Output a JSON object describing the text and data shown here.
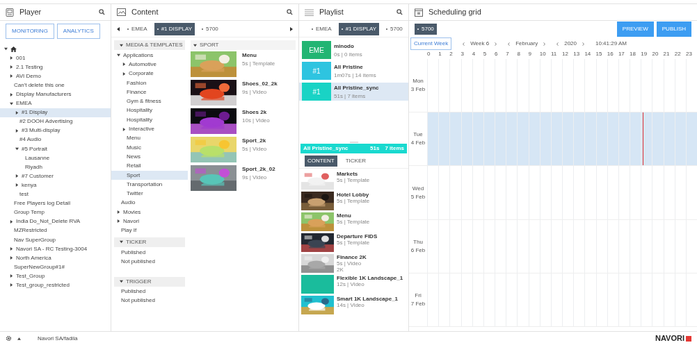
{
  "player": {
    "title": "Player",
    "buttons": [
      {
        "label": "MONITORING"
      },
      {
        "label": "ANALYTICS"
      }
    ],
    "tree": [
      {
        "kind": "home",
        "expanded": true,
        "selected": false,
        "children": [
          {
            "label": "001",
            "expanded": false,
            "selected": false
          },
          {
            "label": "2.1 Testing",
            "expanded": false,
            "selected": false
          },
          {
            "label": "AVI Demo",
            "expanded": false,
            "selected": false
          },
          {
            "label": "Can't delete this one",
            "selected": false
          },
          {
            "label": "Display Manufacturers",
            "expanded": false,
            "selected": false
          },
          {
            "label": "EMEA",
            "expanded": true,
            "selected": false,
            "children": [
              {
                "label": "#1 Display",
                "expanded": false,
                "selected": true
              },
              {
                "label": "#2 DOOH Advertising",
                "selected": false
              },
              {
                "label": "#3 Multi-display",
                "expanded": false,
                "selected": false
              },
              {
                "label": "#4 Audio",
                "selected": false
              },
              {
                "label": "#5 Portrait",
                "expanded": true,
                "selected": false,
                "children": [
                  {
                    "label": "Lausanne",
                    "selected": false
                  },
                  {
                    "label": "Riyadh",
                    "selected": false
                  }
                ]
              },
              {
                "label": "#7 Customer",
                "expanded": false,
                "selected": false
              },
              {
                "label": "kenya",
                "expanded": false,
                "selected": false
              },
              {
                "label": "test",
                "selected": false
              }
            ]
          },
          {
            "label": "Free Players log Detail",
            "selected": false
          },
          {
            "label": "Group Temp",
            "selected": false
          },
          {
            "label": "India Do_Not_Delete RVA",
            "expanded": false,
            "selected": false
          },
          {
            "label": "MZRestricted",
            "selected": false
          },
          {
            "label": "Nav SuperGroup",
            "selected": false
          },
          {
            "label": "Navori SA - RC Testing-3004",
            "expanded": false,
            "selected": false
          },
          {
            "label": "North America",
            "expanded": false,
            "selected": false
          },
          {
            "label": "SuperNewGroup#1#",
            "selected": false
          },
          {
            "label": "Test_Group",
            "expanded": false,
            "selected": false
          },
          {
            "label": "Test_group_restricted",
            "expanded": false,
            "selected": false
          }
        ]
      }
    ]
  },
  "content": {
    "title": "Content",
    "breadcrumb": [
      {
        "label": "EMEA",
        "selected": false
      },
      {
        "label": "#1 DISPLAY",
        "selected": true
      },
      {
        "label": "5700",
        "selected": false
      }
    ],
    "sections": [
      {
        "title": "MEDIA & TEMPLATES",
        "expanded": true,
        "children": [
          {
            "label": "Applications",
            "expanded": true,
            "selected": false,
            "children": [
              {
                "label": "Automotive",
                "expanded": false,
                "selected": false
              },
              {
                "label": "Corporate",
                "expanded": false,
                "selected": false
              },
              {
                "label": "Fashion",
                "selected": false
              },
              {
                "label": "Finance",
                "selected": false
              },
              {
                "label": "Gym & fitness",
                "selected": false
              },
              {
                "label": "Hospitality",
                "selected": false
              },
              {
                "label": "Hospitality",
                "selected": false
              },
              {
                "label": "Interactive",
                "expanded": false,
                "selected": false
              },
              {
                "label": "Menu",
                "selected": false
              },
              {
                "label": "Music",
                "selected": false
              },
              {
                "label": "News",
                "selected": false
              },
              {
                "label": "Retail",
                "selected": false
              },
              {
                "label": "Sport",
                "selected": true
              },
              {
                "label": "Transportation",
                "selected": false
              },
              {
                "label": "Twitter",
                "selected": false
              }
            ]
          },
          {
            "label": "Audio",
            "selected": false
          },
          {
            "label": "Movies",
            "expanded": false,
            "selected": false
          },
          {
            "label": "Navori",
            "expanded": false,
            "selected": false
          },
          {
            "label": "Play If",
            "selected": false
          }
        ]
      },
      {
        "title": "TICKER",
        "expanded": true,
        "children": [
          {
            "label": "Published",
            "selected": false
          },
          {
            "label": "Not published",
            "selected": false
          }
        ]
      },
      {
        "title": "TRIGGER",
        "expanded": true,
        "children": [
          {
            "label": "Published",
            "selected": false
          },
          {
            "label": "Not published",
            "selected": false
          }
        ]
      }
    ],
    "folder": {
      "title": "SPORT",
      "expanded": true
    },
    "media": [
      {
        "name": "Menu",
        "meta": "5s | Template"
      },
      {
        "name": "Shoes_02_2k",
        "meta": "9s | Video"
      },
      {
        "name": "Shoes 2k",
        "meta": "10s | Video"
      },
      {
        "name": "Sport_2k",
        "meta": "5s | Video"
      },
      {
        "name": "Sport_2k_02",
        "meta": "9s | Video"
      }
    ]
  },
  "playlist": {
    "title": "Playlist",
    "breadcrumb": [
      {
        "label": "EMEA",
        "selected": false
      },
      {
        "label": "#1 DISPLAY",
        "selected": true
      },
      {
        "label": "5700",
        "selected": false
      }
    ],
    "playlists": [
      {
        "badge": "EME",
        "color": "#22b573",
        "name": "minodo",
        "meta": "0s | 0 items",
        "selected": false
      },
      {
        "badge": "#1",
        "color": "#2ec4e0",
        "name": "All Pristine",
        "meta": "1m07s | 14 items",
        "selected": false
      },
      {
        "badge": "#1",
        "color": "#19d3c5",
        "name": "All Pristine_sync",
        "meta": "51s | 7 items",
        "selected": true
      }
    ],
    "now": {
      "name": "All Pristine_sync",
      "duration": "51s",
      "count": "7 items"
    },
    "tabs": [
      {
        "label": "CONTENT",
        "selected": true
      },
      {
        "label": "TICKER",
        "selected": false
      }
    ],
    "items": [
      {
        "kind": "picture",
        "name": "Markets",
        "meta": "5s | Template"
      },
      {
        "kind": "picture",
        "name": "Hotel Lobby",
        "meta": "5s | Template"
      },
      {
        "kind": "picture",
        "name": "Menu",
        "meta": "5s | Template"
      },
      {
        "kind": "picture",
        "name": "Departure FIDS",
        "meta": "5s | Template"
      },
      {
        "kind": "picture",
        "name": "Finance 2K",
        "meta": "5s | Video",
        "extra": "2K"
      },
      {
        "kind": "swatch",
        "color": "#1abc9c",
        "name": "Flexible 1K Landscape_1",
        "meta": "12s | Video"
      },
      {
        "kind": "picture",
        "name": "Smart 1K Landscape_1",
        "meta": "14s | Video"
      }
    ]
  },
  "schedule": {
    "title": "Scheduling grid",
    "chip": "5700",
    "buttons": [
      {
        "label": "PREVIEW"
      },
      {
        "label": "PUBLISH"
      }
    ],
    "current_week": "Current Week",
    "week": "Week 6",
    "month": "February",
    "year": "2020",
    "time": "10:41:29 AM",
    "hours": [
      "0",
      "1",
      "2",
      "3",
      "4",
      "5",
      "6",
      "7",
      "8",
      "9",
      "10",
      "11",
      "12",
      "13",
      "14",
      "15",
      "16",
      "17",
      "18",
      "19",
      "20",
      "21",
      "22",
      "23"
    ],
    "days": [
      {
        "day": "Mon",
        "date": "3 Feb",
        "selected": false
      },
      {
        "day": "Tue",
        "date": "4 Feb",
        "selected": true,
        "level": 0.8
      },
      {
        "day": "Wed",
        "date": "5 Feb",
        "selected": false
      },
      {
        "day": "Thu",
        "date": "6 Feb",
        "selected": false
      },
      {
        "day": "Fri",
        "date": "7 Feb",
        "selected": false
      }
    ]
  },
  "footer": {
    "user": "Navori SA/fadila",
    "logo": "NAVORI"
  }
}
